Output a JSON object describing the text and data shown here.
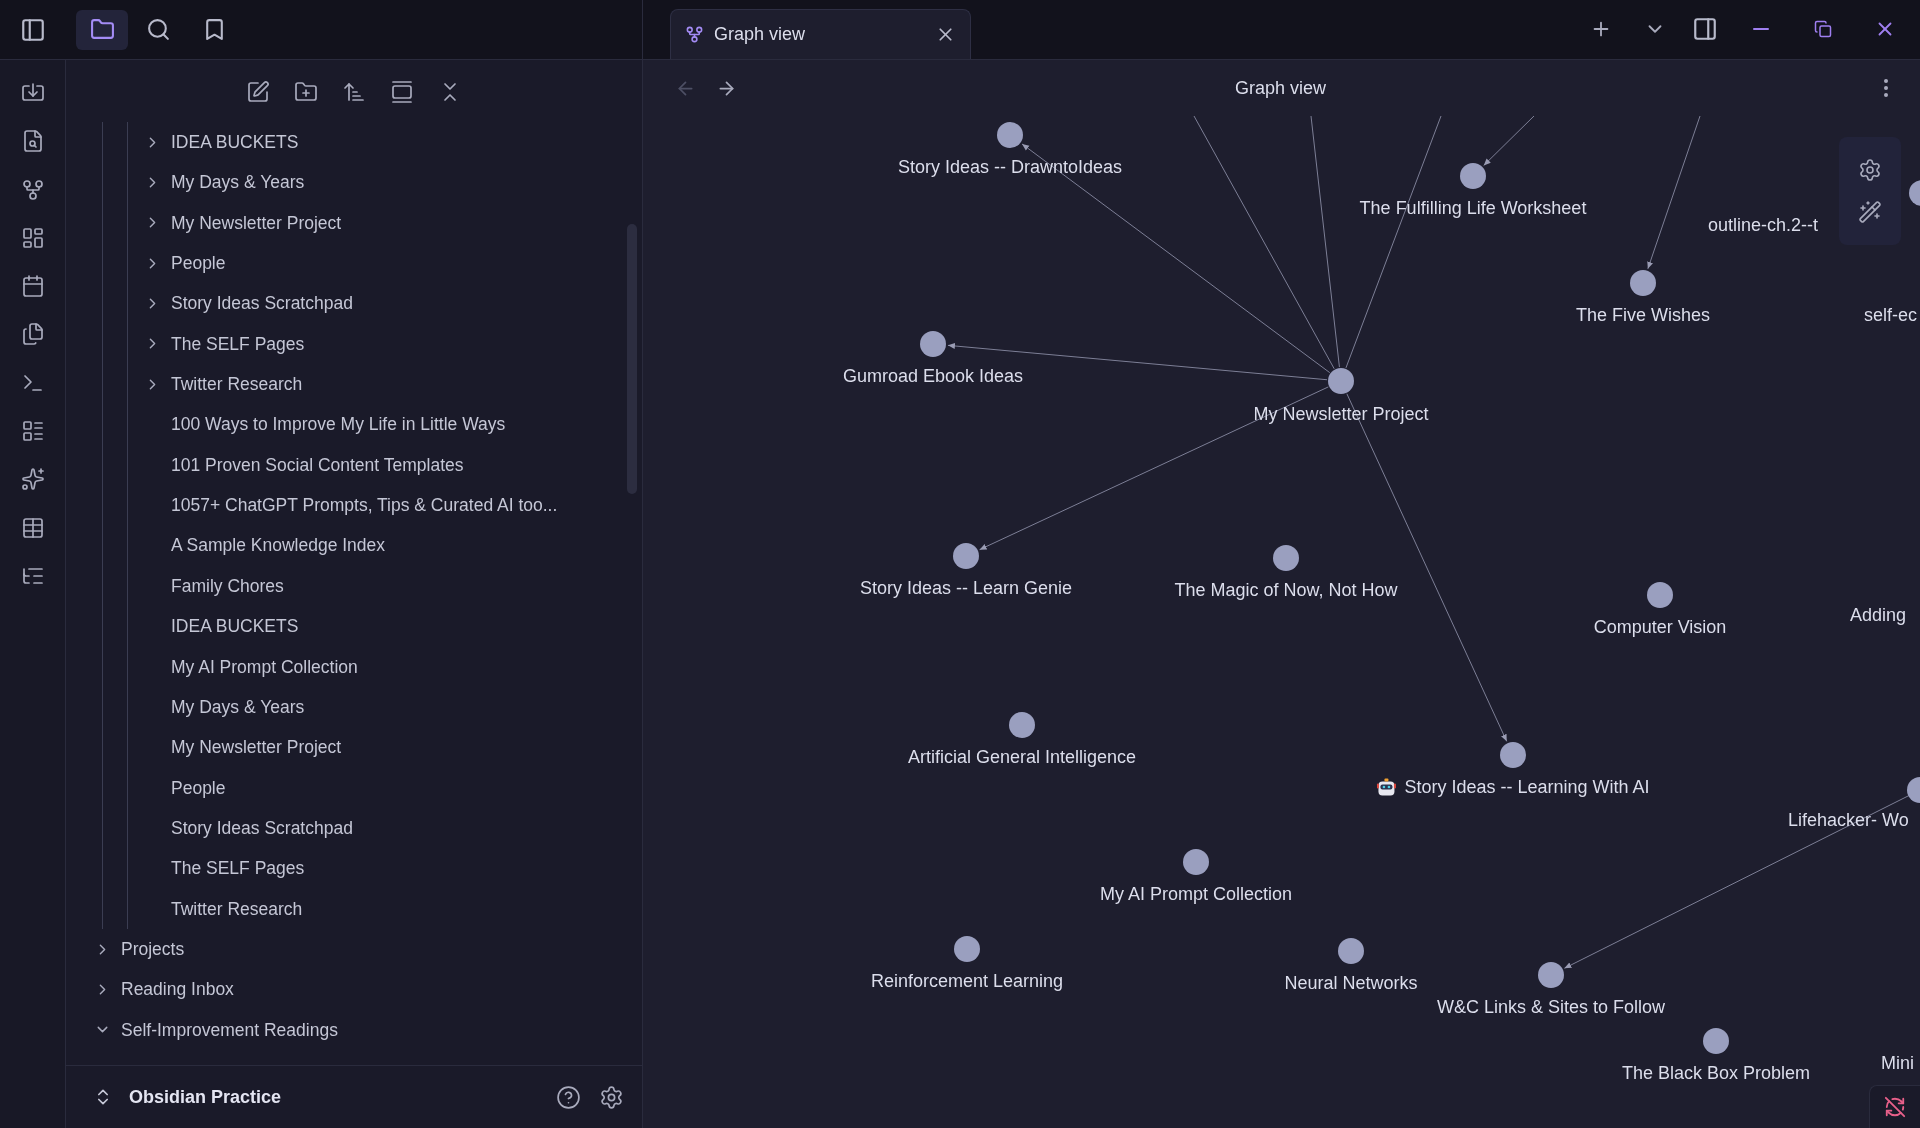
{
  "sidebar_tabs": [
    {
      "kind": "files",
      "selected": true
    },
    {
      "kind": "search",
      "selected": false
    },
    {
      "kind": "bookmarks",
      "selected": false
    }
  ],
  "file_tree": [
    {
      "children": [
        {
          "children": [
            {
              "name": "IDEA BUCKETS",
              "kind": "folder",
              "expanded": false
            },
            {
              "name": "My Days & Years",
              "kind": "folder",
              "expanded": false
            },
            {
              "name": "My Newsletter Project",
              "kind": "folder",
              "expanded": false
            },
            {
              "name": "People",
              "kind": "folder",
              "expanded": false
            },
            {
              "name": "Story Ideas Scratchpad",
              "kind": "folder",
              "expanded": false
            },
            {
              "name": "The SELF Pages",
              "kind": "folder",
              "expanded": false
            },
            {
              "name": "Twitter Research",
              "kind": "folder",
              "expanded": false
            },
            {
              "name": "100 Ways to Improve My Life in Little Ways",
              "kind": "file"
            },
            {
              "name": "101 Proven Social Content Templates",
              "kind": "file"
            },
            {
              "name": "1057+ ChatGPT Prompts, Tips & Curated AI too...",
              "kind": "file"
            },
            {
              "name": "A Sample Knowledge Index",
              "kind": "file"
            },
            {
              "name": "Family Chores",
              "kind": "file"
            },
            {
              "name": "IDEA BUCKETS",
              "kind": "file"
            },
            {
              "name": "My AI Prompt Collection",
              "kind": "file"
            },
            {
              "name": "My Days & Years",
              "kind": "file"
            },
            {
              "name": "My Newsletter  Project",
              "kind": "file"
            },
            {
              "name": "People",
              "kind": "file"
            },
            {
              "name": "Story Ideas Scratchpad",
              "kind": "file"
            },
            {
              "name": "The SELF Pages",
              "kind": "file"
            },
            {
              "name": "Twitter Research",
              "kind": "file"
            }
          ]
        }
      ]
    },
    {
      "name": "Projects",
      "kind": "folder",
      "expanded": false
    },
    {
      "name": "Reading Inbox",
      "kind": "folder",
      "expanded": false
    },
    {
      "name": "Self-Improvement Readings",
      "kind": "folder",
      "expanded": true
    }
  ],
  "vault": {
    "name": "Obsidian Practice"
  },
  "tab": {
    "title": "Graph view",
    "selected": true
  },
  "view_header": {
    "title": "Graph view",
    "back_disabled": true,
    "forward_disabled": false
  },
  "graph": {
    "nodes": [
      {
        "label": "Story Ideas -- DrawntoIdeas",
        "kind": "note"
      },
      {
        "label": "The Fulfilling Life Worksheet",
        "kind": "note"
      },
      {
        "label": "outline-ch.2--t",
        "kind": "note"
      },
      {
        "label": "The Five Wishes",
        "kind": "note"
      },
      {
        "label": "self-ec",
        "kind": "note"
      },
      {
        "label": "Gumroad Ebook Ideas",
        "kind": "note"
      },
      {
        "label": "My Newsletter  Project",
        "kind": "note"
      },
      {
        "label": "Story Ideas -- Learn Genie",
        "kind": "note"
      },
      {
        "label": "The Magic of Now, Not How",
        "kind": "note"
      },
      {
        "label": "Computer Vision",
        "kind": "note"
      },
      {
        "label": "Adding",
        "kind": "note"
      },
      {
        "label": "Artificial General Intelligence",
        "kind": "note"
      },
      {
        "label": "Story Ideas -- Learning With AI",
        "kind": "note_with_icon"
      },
      {
        "label": "Lifehacker- Wo",
        "kind": "note"
      },
      {
        "label": "My AI Prompt Collection",
        "kind": "note"
      },
      {
        "label": "Reinforcement Learning",
        "kind": "note"
      },
      {
        "label": "Neural Networks",
        "kind": "note"
      },
      {
        "label": "W&C Links & Sites to Follow",
        "kind": "note"
      },
      {
        "label": "The Black Box Problem",
        "kind": "note"
      },
      {
        "label": "Mini",
        "kind": "note"
      }
    ]
  }
}
